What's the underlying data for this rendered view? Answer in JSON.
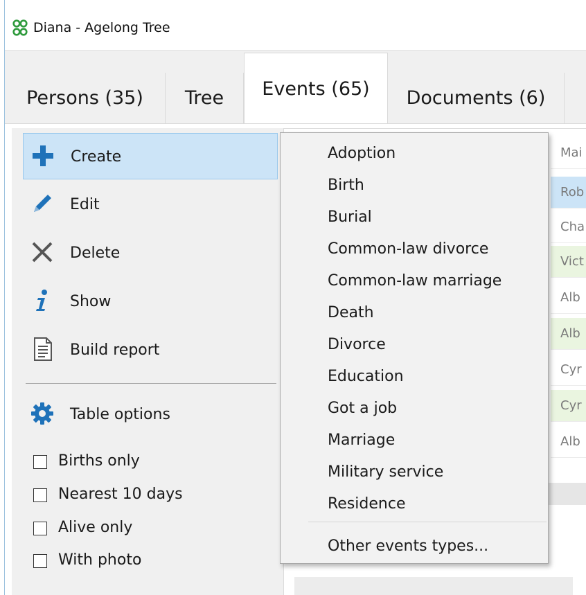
{
  "window": {
    "title": "Diana - Agelong Tree"
  },
  "tabs": [
    {
      "label": "Persons (35)"
    },
    {
      "label": "Tree"
    },
    {
      "label": "Events (65)"
    },
    {
      "label": "Documents (6)"
    }
  ],
  "actions": {
    "create": {
      "label": "Create",
      "icon": "plus-icon"
    },
    "edit": {
      "label": "Edit",
      "icon": "pencil-icon"
    },
    "delete": {
      "label": "Delete",
      "icon": "cross-icon"
    },
    "show": {
      "label": "Show",
      "icon": "info-icon"
    },
    "build_report": {
      "label": "Build report",
      "icon": "document-icon"
    },
    "table_options": {
      "label": "Table options",
      "icon": "gear-icon"
    }
  },
  "filters": [
    {
      "label": "Births only",
      "checked": false
    },
    {
      "label": "Nearest 10 days",
      "checked": false
    },
    {
      "label": "Alive only",
      "checked": false
    },
    {
      "label": "With photo",
      "checked": false
    }
  ],
  "create_menu": {
    "items": [
      "Adoption",
      "Birth",
      "Burial",
      "Common-law divorce",
      "Common-law marriage",
      "Death",
      "Divorce",
      "Education",
      "Got a job",
      "Marriage",
      "Military service",
      "Residence"
    ],
    "other": "Other events types..."
  },
  "table": {
    "header": "Mai",
    "rows": [
      "Rob",
      "Cha",
      "Vict",
      "Alb",
      "Alb",
      "Cyr",
      "Cyr",
      "Alb"
    ]
  },
  "colors": {
    "accent": "#1f72b9",
    "selection": "#cce4f7",
    "app_icon": "#2e9a3c"
  }
}
